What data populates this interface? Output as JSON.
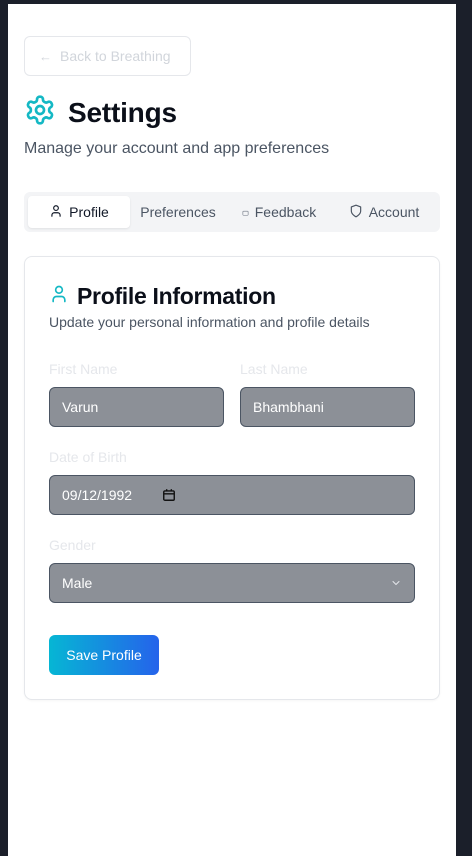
{
  "back_button": {
    "label": "Back to Breathing"
  },
  "header": {
    "title": "Settings",
    "subtitle": "Manage your account and app preferences"
  },
  "tabs": [
    {
      "label": "Profile",
      "icon": "user-icon",
      "active": true
    },
    {
      "label": "Preferences",
      "icon": "",
      "active": false
    },
    {
      "label": "Feedback",
      "icon": "message-icon",
      "active": false
    },
    {
      "label": "Account",
      "icon": "shield-icon",
      "active": false
    }
  ],
  "profile_card": {
    "title": "Profile Information",
    "description": "Update your personal information and profile details",
    "first_name": {
      "label": "First Name",
      "value": "Varun"
    },
    "last_name": {
      "label": "Last Name",
      "value": "Bhambhani"
    },
    "dob": {
      "label": "Date of Birth",
      "value": "09/12/1992"
    },
    "gender": {
      "label": "Gender",
      "value": "Male"
    },
    "save_label": "Save Profile"
  },
  "colors": {
    "accent": "#14b8c4",
    "button_gradient_start": "#06b6d4",
    "button_gradient_end": "#2563eb",
    "input_bg": "#8c9097"
  }
}
